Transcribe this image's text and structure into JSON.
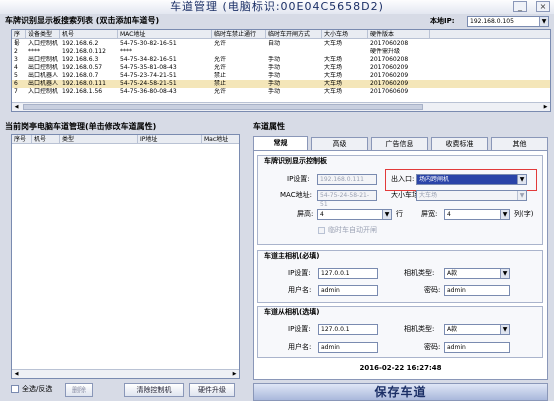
{
  "window": {
    "title": "车道管理 (电脑标识:00E04C5658D2)",
    "minimize_label": "_",
    "close_label": "×"
  },
  "board_list": {
    "title": "车牌识别显示板搜索列表 (双击添加车道号)",
    "local_ip_label": "本地IP:",
    "local_ip_value": "192.168.0.105",
    "columns": [
      "序号",
      "设备类型",
      "机号",
      "MAC地址",
      "临时车禁止通行",
      "临时车开闸方式",
      "大小车场",
      "硬件版本"
    ],
    "rows": [
      [
        "1",
        "入口控制机",
        "192.168.6.2",
        "54-75-30-82-16-51",
        "允许",
        "自动",
        "大车场",
        "2017060208"
      ],
      [
        "2",
        "****",
        "192.168.0.112",
        "****",
        "",
        "",
        "",
        "硬件需升级"
      ],
      [
        "3",
        "出口控制机",
        "192.168.6.3",
        "54-75-34-82-16-51",
        "允许",
        "手动",
        "大车场",
        "2017060208"
      ],
      [
        "4",
        "出口控制机",
        "192.168.0.57",
        "54-75-35-81-08-43",
        "允许",
        "手动",
        "大车场",
        "2017060209"
      ],
      [
        "5",
        "出口机器人",
        "192.168.0.7",
        "54-75-23-74-21-51",
        "禁止",
        "手动",
        "大车场",
        "2017060209"
      ],
      [
        "6",
        "出口机器人",
        "192.168.0.111",
        "54-75-24-58-21-51",
        "禁止",
        "手动",
        "大车场",
        "2017060209"
      ],
      [
        "7",
        "入口控制机",
        "192.168.1.56",
        "54-75-36-80-08-43",
        "允许",
        "手动",
        "大车场",
        "2017060609"
      ]
    ],
    "selected_row": 5
  },
  "lane_list": {
    "title": "当前岗亭电脑车道管理(单击修改车道属性)",
    "columns": [
      "序号",
      "机号",
      "类型",
      "IP地址",
      "Mac地址"
    ],
    "select_all_label": "全选/反选",
    "delete_label": "删除",
    "clear_label": "清除控制机",
    "upgrade_label": "硬件升级"
  },
  "props": {
    "title": "车道属性",
    "tabs": [
      "常规",
      "高级",
      "广告信息",
      "收费标准",
      "其他"
    ],
    "active_tab": 0,
    "board_group": {
      "title": "车牌识别显示控制板",
      "ip_label": "IP设置:",
      "ip_value": "192.168.0.111",
      "mac_label": "MAC地址:",
      "mac_value": "54-75-24-58-21-51",
      "entrance_label": "出入口:",
      "entrance_value": "场内跨闸机",
      "lot_label": "大小车场:",
      "lot_value": "大车场",
      "height_label": "屏高:",
      "height_value": "4",
      "height_unit": "行",
      "width_label": "屏宽:",
      "width_value": "4",
      "width_unit": "列(字)",
      "auto_open_label": "临时车自动开闸"
    },
    "main_camera": {
      "title": "车道主相机(必填)",
      "ip_label": "IP设置:",
      "ip_value": "127.0.0.1",
      "type_label": "相机类型:",
      "type_value": "A款",
      "user_label": "用户名:",
      "user_value": "admin",
      "pwd_label": "密码:",
      "pwd_value": "admin"
    },
    "sub_camera": {
      "title": "车道从相机(选填)",
      "ip_label": "IP设置:",
      "ip_value": "127.0.0.1",
      "type_label": "相机类型:",
      "type_value": "A款",
      "user_label": "用户名:",
      "user_value": "admin",
      "pwd_label": "密码:",
      "pwd_value": "admin"
    },
    "datetime": "2016-02-22 16:27:48",
    "save_label": "保存车道"
  },
  "colors": {
    "selected_row": "#f4e6b9",
    "highlight_border": "#e23a3a",
    "save_button_top": "#c8d3ea"
  }
}
